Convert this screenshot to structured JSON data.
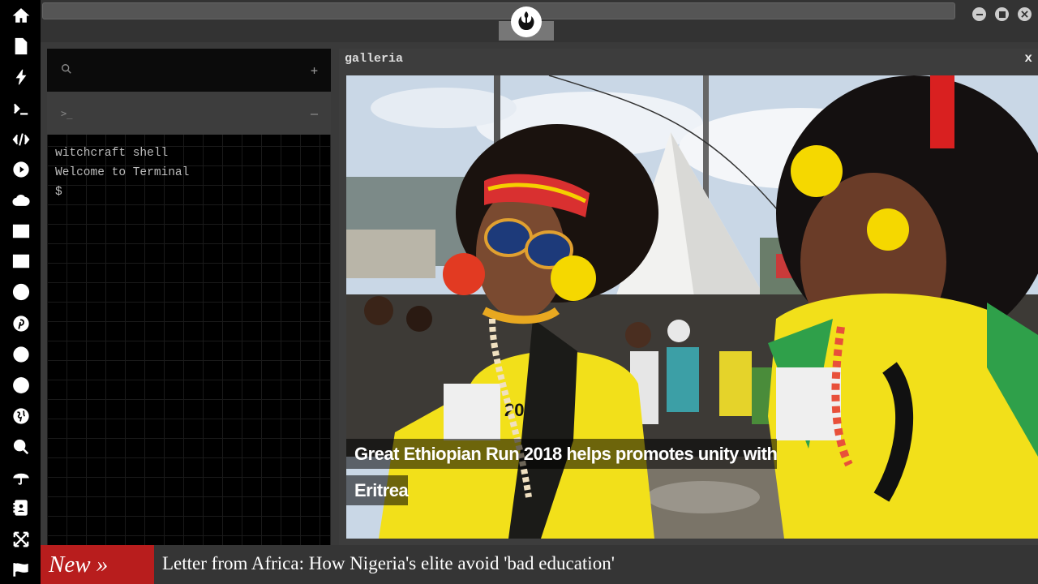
{
  "dock": {
    "icons": [
      "home-icon",
      "document-icon",
      "bolt-icon",
      "terminal-icon",
      "code-icon",
      "play-icon",
      "cloud-icon",
      "image-icon",
      "newspaper-icon",
      "wordpress-icon",
      "pinterest-icon",
      "galactic-empire-icon",
      "globe-mesh-icon",
      "globe-icon",
      "search-icon",
      "umbrella-icon",
      "address-book-icon",
      "expand-arrows-icon",
      "flag-icon"
    ]
  },
  "topbar": {
    "logo": "rebel-alliance-logo",
    "window_controls": [
      "minimize",
      "maximize",
      "close"
    ]
  },
  "terminal": {
    "search_action": "+",
    "prompt_icon": ">_",
    "prompt_action": "–",
    "lines": [
      "witchcraft shell",
      "Welcome to Terminal",
      "$"
    ]
  },
  "galleria": {
    "title": "galleria",
    "close_label": "x",
    "caption": "Great Ethiopian Run 2018 helps promotes unity with Eritrea"
  },
  "ticker": {
    "badge": "New »",
    "headline": "Letter from Africa: How Nigeria's elite avoid 'bad education'"
  },
  "colors": {
    "ticker_badge": "#b81d1d",
    "window_bg": "#3d3d3d",
    "terminal_bg": "#000000"
  }
}
